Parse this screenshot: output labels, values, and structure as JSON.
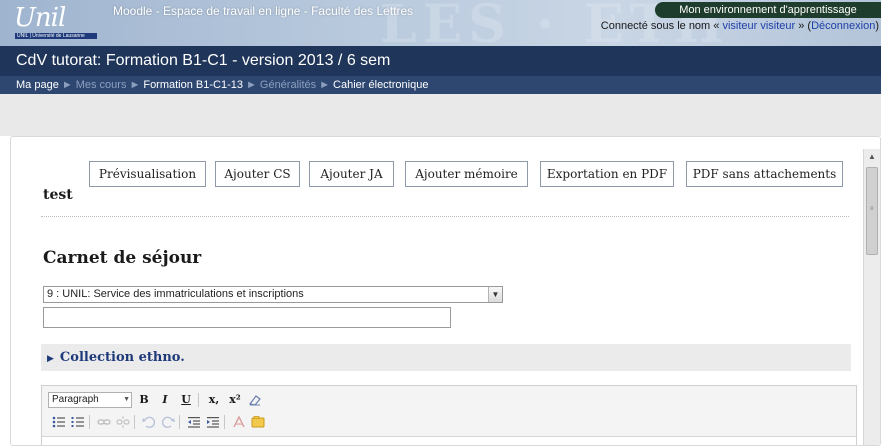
{
  "header": {
    "logo_text": "Unil",
    "logo_subtitle": "UNIL | Université de Lausanne",
    "site_title": "Moodle - Espace de travail en ligne - Faculté des Lettres",
    "env_tab": "Mon environnement d'apprentissage",
    "login_prefix": "Connecté sous le nom « ",
    "login_user": "visiteur visiteur",
    "login_mid": " » (",
    "logout_label": "Déconnexion",
    "login_suffix": ")"
  },
  "course_title": "CdV tutorat: Formation B1-C1 - version 2013 / 6 sem",
  "breadcrumb": {
    "items": [
      "Ma page",
      "Mes cours",
      "Formation B1-C1-13",
      "Généralités",
      "Cahier électronique"
    ]
  },
  "toolbar_buttons": [
    "Prévisualisation",
    "Ajouter CS",
    "Ajouter JA",
    "Ajouter mémoire",
    "Exportation en PDF",
    "PDF sans attachements"
  ],
  "page_heading": "test",
  "section_heading": "Carnet de séjour",
  "selected_option": "9 : UNIL: Service des immatriculations et inscriptions",
  "text_input_value": "",
  "collapsible_section": "Collection ethno.",
  "editor": {
    "format_select": "Paragraph",
    "bold": "B",
    "italic": "I",
    "underline": "U",
    "subscript": "x,",
    "superscript": "x²"
  },
  "colors": {
    "title_bar": "#1f3559",
    "nav_bar": "#2e4770",
    "link": "#1d3fa8",
    "section_title": "#1f3a7a"
  }
}
